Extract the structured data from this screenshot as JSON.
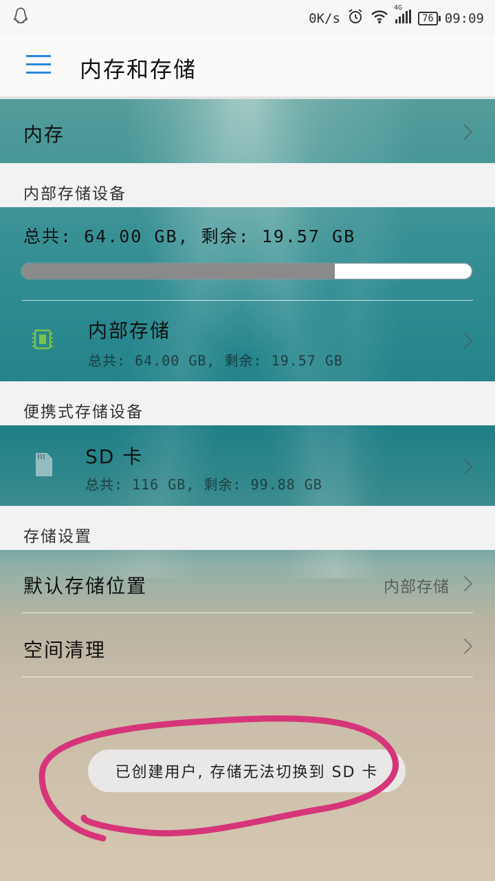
{
  "status_bar": {
    "network_speed": "0K/s",
    "network_type": "4G",
    "battery": "76",
    "time": "09:09",
    "icons": [
      "qq-icon",
      "alarm-icon",
      "wifi-icon",
      "signal-icon",
      "battery-icon"
    ]
  },
  "header": {
    "title": "内存和存储",
    "menu_icon": "hamburger-menu-icon"
  },
  "memory_row": {
    "label": "内存"
  },
  "internal_section": {
    "header": "内部存储设备",
    "summary": "总共: 64.00 GB, 剩余: 19.57 GB",
    "used_fraction": 0.695,
    "item": {
      "title": "内部存储",
      "detail": "总共: 64.00 GB, 剩余: 19.57 GB",
      "icon": "chip-icon"
    }
  },
  "portable_section": {
    "header": "便携式存储设备",
    "item": {
      "title": "SD 卡",
      "detail": "总共: 116 GB, 剩余: 99.88 GB",
      "icon": "sd-card-icon"
    }
  },
  "settings_section": {
    "header": "存储设置",
    "default_location": {
      "label": "默认存储位置",
      "value": "内部存储"
    },
    "cleanup": {
      "label": "空间清理"
    }
  },
  "toast": {
    "text": "已创建用户, 存储无法切换到 SD 卡"
  },
  "colors": {
    "accent": "#2a86d9",
    "annotation": "#d6357a",
    "progress_used": "#8a8a8a"
  }
}
